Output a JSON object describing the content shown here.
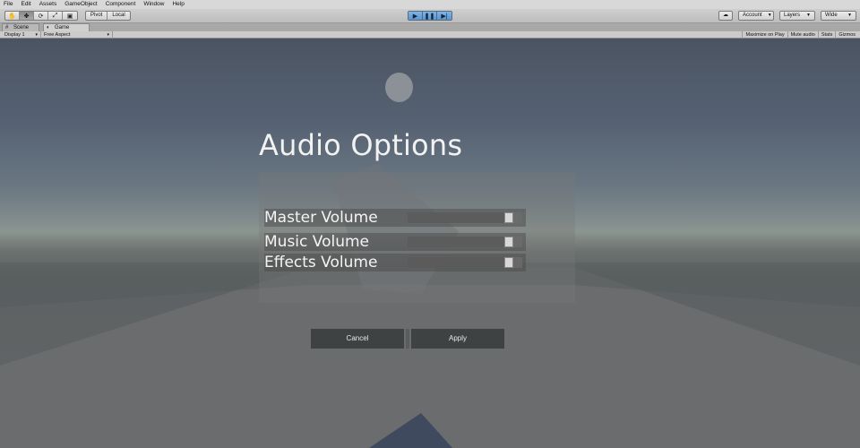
{
  "menu": [
    "File",
    "Edit",
    "Assets",
    "GameObject",
    "Component",
    "Window",
    "Help"
  ],
  "toolbar": {
    "transform_tools": [
      {
        "icon": "hand-icon",
        "glyph": "✋"
      },
      {
        "icon": "move-icon",
        "glyph": "✥"
      },
      {
        "icon": "rotate-icon",
        "glyph": "⟳"
      },
      {
        "icon": "scale-icon",
        "glyph": "⤢"
      },
      {
        "icon": "rect-icon",
        "glyph": "▣"
      }
    ],
    "pivot": "Pivot",
    "local": "Local",
    "play": {
      "play_icon": "▶",
      "pause_icon": "❚❚",
      "step_icon": "▶|"
    },
    "cloud_icon": "☁",
    "account": "Account",
    "layers": "Layers",
    "layout": "Wide"
  },
  "tabs": {
    "scene": "Scene",
    "game": "Game"
  },
  "gamebar": {
    "display": "Display 1",
    "aspect": "Free Aspect",
    "maximize": "Maximize on Play",
    "mute": "Mute audio",
    "stats": "Stats",
    "gizmos": "Gizmos"
  },
  "menu_ui": {
    "title": "Audio Options",
    "sliders": [
      {
        "label": "Master Volume",
        "value": 0.88
      },
      {
        "label": "Music Volume",
        "value": 0.88
      },
      {
        "label": "Effects Volume",
        "value": 0.88
      }
    ],
    "cancel": "Cancel",
    "apply": "Apply"
  }
}
